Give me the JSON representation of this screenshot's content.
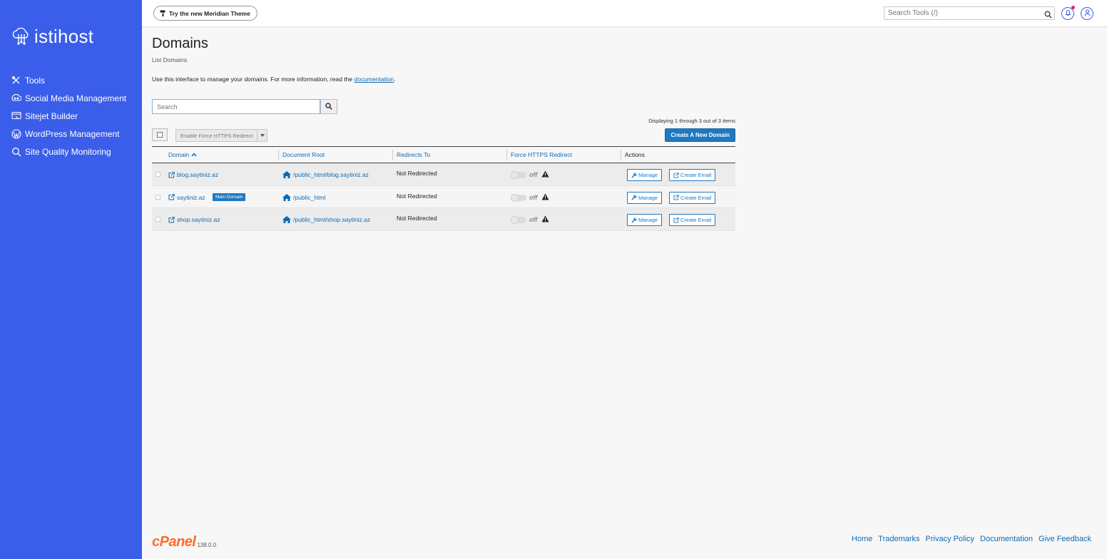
{
  "brand": {
    "name": "istihost"
  },
  "sidebar": {
    "items": [
      {
        "label": "Tools",
        "icon": "tools-icon"
      },
      {
        "label": "Social Media Management",
        "icon": "social-icon"
      },
      {
        "label": "Sitejet Builder",
        "icon": "sitejet-icon"
      },
      {
        "label": "WordPress Management",
        "icon": "wordpress-icon"
      },
      {
        "label": "Site Quality Monitoring",
        "icon": "monitoring-icon"
      }
    ]
  },
  "topbar": {
    "theme_button": "Try the new Meridian Theme",
    "search_placeholder": "Search Tools (/)"
  },
  "page": {
    "title": "Domains",
    "subtitle": "List Domains",
    "intro_text": "Use this interface to manage your domains. For more information, read the ",
    "intro_link": "documentation",
    "intro_end": "."
  },
  "toolbar": {
    "search_placeholder": "Search",
    "displaying": "Displaying 1 through 3 out of 3 items",
    "bulk_action": "Enable Force HTTPS Redirect",
    "create_button": "Create A New Domain"
  },
  "table": {
    "columns": [
      "Domain",
      "Document Root",
      "Redirects To",
      "Force HTTPS Redirect",
      "Actions"
    ],
    "rows": [
      {
        "domain": "blog.saytiniz.az",
        "badge": "",
        "doc_root": "/public_html/blog.saytiniz.az",
        "redirect": "Not Redirected",
        "https": "off"
      },
      {
        "domain": "saytiniz.az",
        "badge": "Main Domain",
        "doc_root": "/public_html",
        "redirect": "Not Redirected",
        "https": "off"
      },
      {
        "domain": "shop.saytiniz.az",
        "badge": "",
        "doc_root": "/public_html/shop.saytiniz.az",
        "redirect": "Not Redirected",
        "https": "off"
      }
    ],
    "manage_label": "Manage",
    "create_email_label": "Create Email"
  },
  "footer": {
    "logo": "cPanel",
    "version": "138.0.0",
    "links": [
      "Home",
      "Trademarks",
      "Privacy Policy",
      "Documentation",
      "Give Feedback"
    ]
  },
  "colors": {
    "sidebar": "#3a5eea",
    "link": "#0d6bb5",
    "primary": "#1f78c1",
    "cpanel": "#ff6c2c"
  }
}
